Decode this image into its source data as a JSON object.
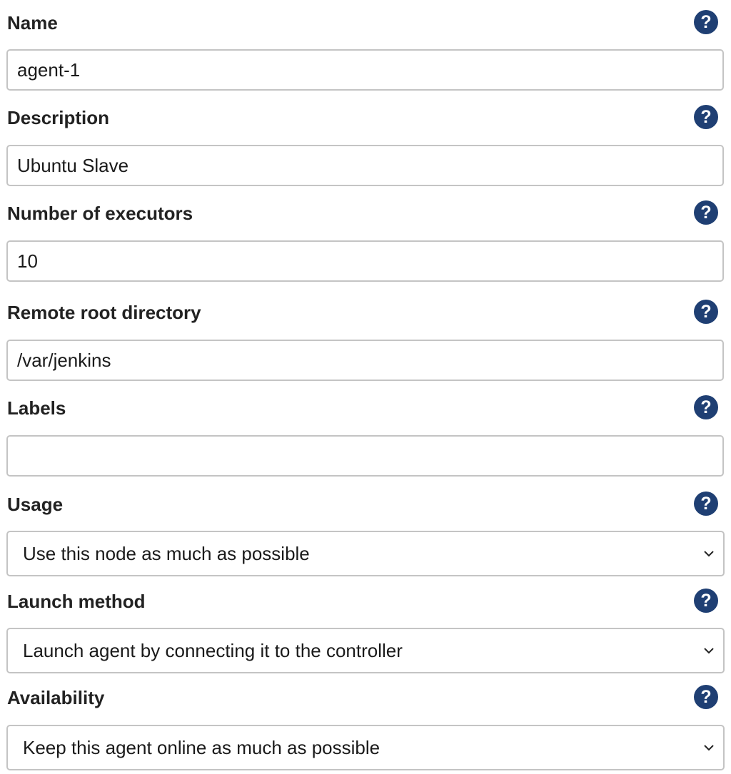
{
  "form": {
    "name": {
      "label": "Name",
      "value": "agent-1",
      "help_icon": "help-icon"
    },
    "description": {
      "label": "Description",
      "value": "Ubuntu Slave",
      "help_icon": "help-icon"
    },
    "executors": {
      "label": "Number of executors",
      "value": "10",
      "help_icon": "help-icon"
    },
    "remote_root": {
      "label": "Remote root directory",
      "value": "/var/jenkins",
      "help_icon": "help-icon"
    },
    "labels": {
      "label": "Labels",
      "value": "",
      "help_icon": "help-icon"
    },
    "usage": {
      "label": "Usage",
      "selected": "Use this node as much as possible",
      "help_icon": "help-icon"
    },
    "launch_method": {
      "label": "Launch method",
      "selected": "Launch agent by connecting it to the controller",
      "help_icon": "help-icon"
    },
    "availability": {
      "label": "Availability",
      "selected": "Keep this agent online as much as possible",
      "help_icon": "help-icon"
    }
  },
  "help_glyph": "?",
  "colors": {
    "help_icon_bg": "#1f3f73",
    "field_border": "#c4c4c4",
    "label_text": "#222222"
  }
}
